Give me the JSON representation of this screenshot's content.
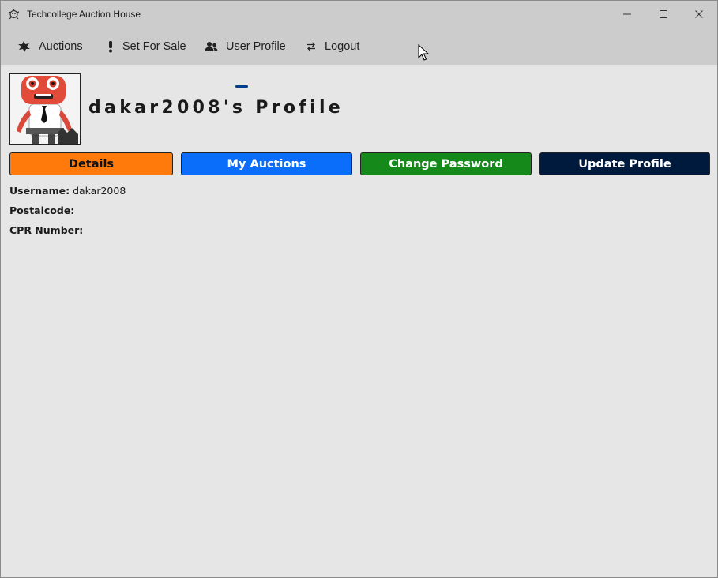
{
  "window": {
    "title": "Techcollege Auction House"
  },
  "nav": {
    "items": [
      {
        "label": "Auctions",
        "icon": "gavel-icon"
      },
      {
        "label": "Set For Sale",
        "icon": "exclamation-icon"
      },
      {
        "label": "User Profile",
        "icon": "users-icon",
        "active": true
      },
      {
        "label": "Logout",
        "icon": "swap-arrows-icon"
      }
    ]
  },
  "profile": {
    "title": "dakar2008's Profile"
  },
  "tabs": {
    "details": "Details",
    "my_auctions": "My Auctions",
    "change_password": "Change Password",
    "update_profile": "Update Profile"
  },
  "details": {
    "username_label": "Username:",
    "username_value": "dakar2008",
    "postalcode_label": "Postalcode:",
    "postalcode_value": "",
    "cpr_label": "CPR Number:",
    "cpr_value": ""
  },
  "colors": {
    "details_button": "#ff7a0a",
    "my_auctions_button": "#0a6efa",
    "change_password_button": "#15891a",
    "update_profile_button": "#001a3d",
    "active_tab_indicator": "#003f8a"
  }
}
